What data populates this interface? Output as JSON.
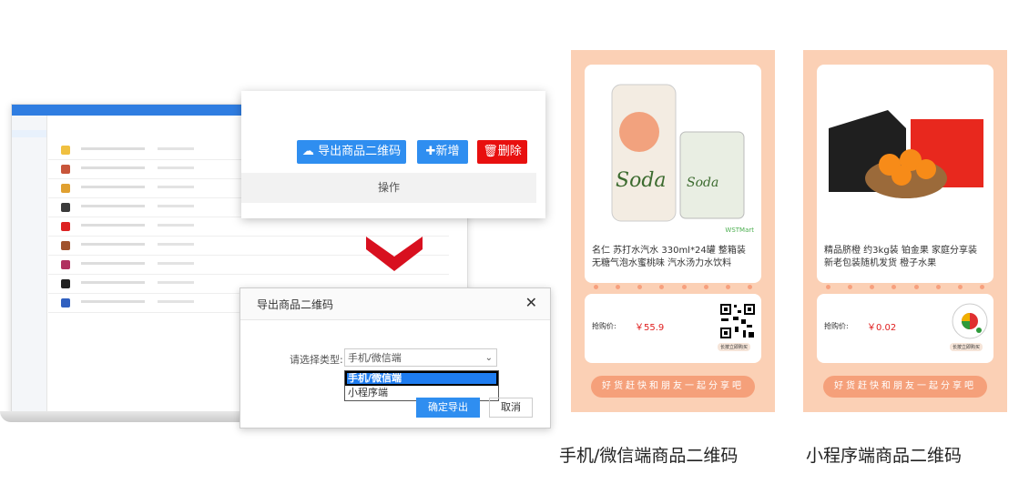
{
  "toolbar": {
    "export_label": "导出商品二维码",
    "add_label": "新增",
    "delete_label": "删除",
    "op_header": "操作"
  },
  "dialog": {
    "title": "导出商品二维码",
    "select_label": "请选择类型:",
    "selected_value": "手机/微信端",
    "options": [
      "手机/微信端",
      "小程序端"
    ],
    "confirm_label": "确定导出",
    "cancel_label": "取消"
  },
  "posters": [
    {
      "product_name": "名仁 苏打水汽水 330ml*24罐 整箱装 无糖气泡水蜜桃味 汽水汤力水饮料",
      "brand": "WSTMart",
      "price_label": "抢购价:",
      "price": "￥55.9",
      "press_label": "长按立即购买",
      "share_text": "好货赶快和朋友一起分享吧",
      "caption": "手机/微信端商品二维码"
    },
    {
      "product_name": "精品脐橙 约3kg装 铂金果 家庭分享装 新老包装随机发货 橙子水果",
      "brand": "",
      "price_label": "抢购价:",
      "price": "￥0.02",
      "press_label": "长按立即购买",
      "share_text": "好货赶快和朋友一起分享吧",
      "caption": "小程序端商品二维码"
    }
  ],
  "colors": {
    "primary": "#2f8ef0",
    "danger": "#e8100f",
    "poster_bg": "#fbd0b5",
    "price": "#e02020",
    "arrow": "#d8101f"
  }
}
